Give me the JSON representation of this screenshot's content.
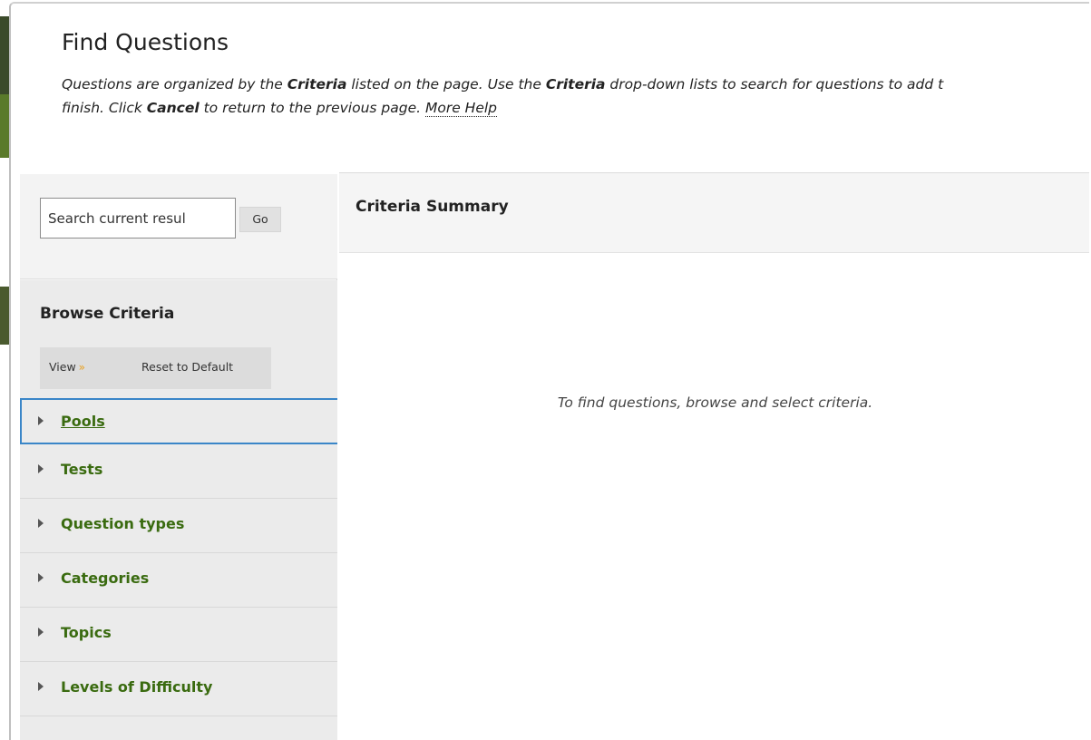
{
  "header": {
    "title": "Find Questions",
    "instructions": {
      "part1": "Questions are organized by the ",
      "criteria_1": "Criteria",
      "part2": " listed on the page. Use the ",
      "criteria_2": "Criteria",
      "part3": " drop-down lists to search for questions to add t",
      "part4": "finish. Click ",
      "cancel": "Cancel",
      "part5": " to return to the previous page. ",
      "more_help": "More Help"
    }
  },
  "search": {
    "placeholder": "Search current results",
    "value": "Search current resul",
    "go_label": "Go"
  },
  "browse": {
    "title": "Browse Criteria",
    "view_label": "View",
    "view_icon": "double-chevron-down-icon",
    "reset_label": "Reset to Default",
    "items": [
      {
        "label": "Pools"
      },
      {
        "label": "Tests"
      },
      {
        "label": "Question types"
      },
      {
        "label": "Categories"
      },
      {
        "label": "Topics"
      },
      {
        "label": "Levels of Difficulty"
      }
    ]
  },
  "main": {
    "summary_title": "Criteria Summary",
    "empty_message": "To find questions, browse and select criteria."
  },
  "colors": {
    "accent_link": "#3a6b10",
    "focus_border": "#3a86c8",
    "view_chevron": "#e8a020"
  }
}
